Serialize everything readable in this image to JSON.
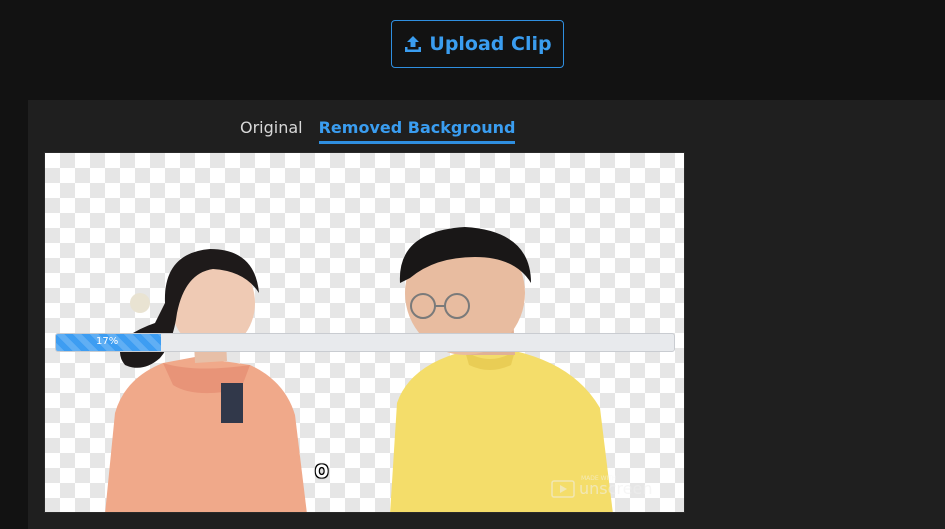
{
  "upload_button": {
    "label": "Upload Clip",
    "icon": "upload-icon"
  },
  "tabs": [
    {
      "label": "Original",
      "active": false
    },
    {
      "label": "Removed Background",
      "active": true
    }
  ],
  "progress": {
    "value": 0.17,
    "label": "17%"
  },
  "video": {
    "subtitle": "𝗈",
    "watermark_small": "MADE WITH",
    "watermark": "unscreen"
  },
  "colors": {
    "accent": "#3a9df0",
    "page_bg": "#121212",
    "panel_bg": "#1f1f1f",
    "progress_fill": "#3d9df2",
    "progress_track": "#e8eaed"
  }
}
